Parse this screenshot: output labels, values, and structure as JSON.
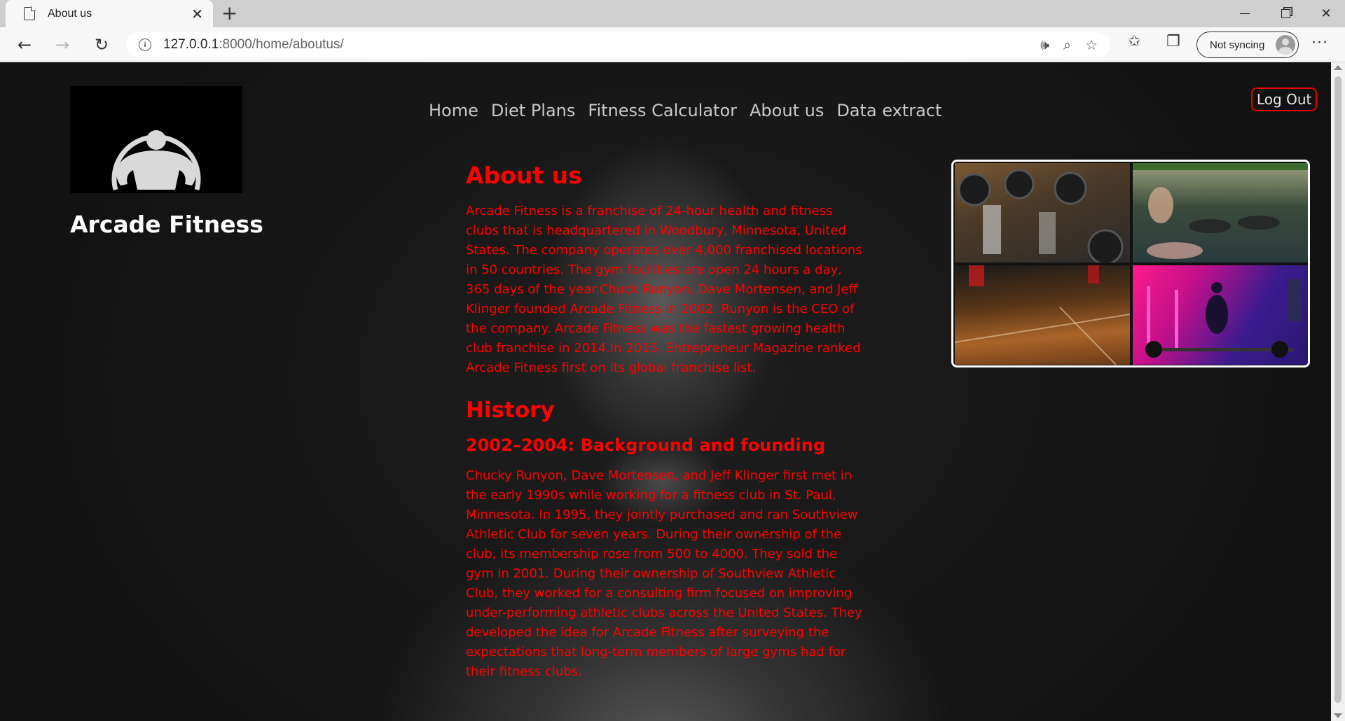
{
  "browser": {
    "tab_title": "About us",
    "url_host": "127.0.0.1",
    "url_rest": ":8000/home/aboutus/",
    "sync_label": "Not syncing"
  },
  "site": {
    "brand": "Arcade Fitness",
    "nav": [
      "Home",
      "Diet Plans",
      "Fitness Calculator",
      "About us",
      "Data extract"
    ],
    "logout": "Log Out"
  },
  "content": {
    "about_heading": "About us",
    "about_text": "Arcade Fitness is a franchise of 24-hour health and fitness clubs that is headquartered in Woodbury, Minnesota, United States. The company operates over 4,000 franchised locations in 50 countries. The gym facilities are open 24 hours a day, 365 days of the year.Chuck Runyon, Dave Mortensen, and Jeff Klinger founded Arcade Fitness in 2002. Runyon is the CEO of the company. Arcade Fitness was the fastest growing health club franchise in 2014.In 2015, Entrepreneur Magazine ranked Arcade Fitness first on its global franchise list.",
    "history_heading": "History",
    "history_subheading": "2002–2004: Background and founding",
    "history_text": "Chucky Runyon, Dave Mortensen, and Jeff Klinger first met in the early 1990s while working for a fitness club in St. Paul, Minnesota. In 1995, they jointly purchased and ran Southview Athletic Club for seven years. During their ownership of the club, its membership rose from 500 to 4000. They sold the gym in 2001. During their ownership of Southview Athletic Club, they worked for a consulting firm focused on improving under-performing athletic clubs across the United States. They developed the idea for Arcade Fitness after surveying the expectations that long-term members of large gyms had for their fitness clubs."
  },
  "colors": {
    "accent": "#ff0000",
    "page_bg": "#121212"
  }
}
